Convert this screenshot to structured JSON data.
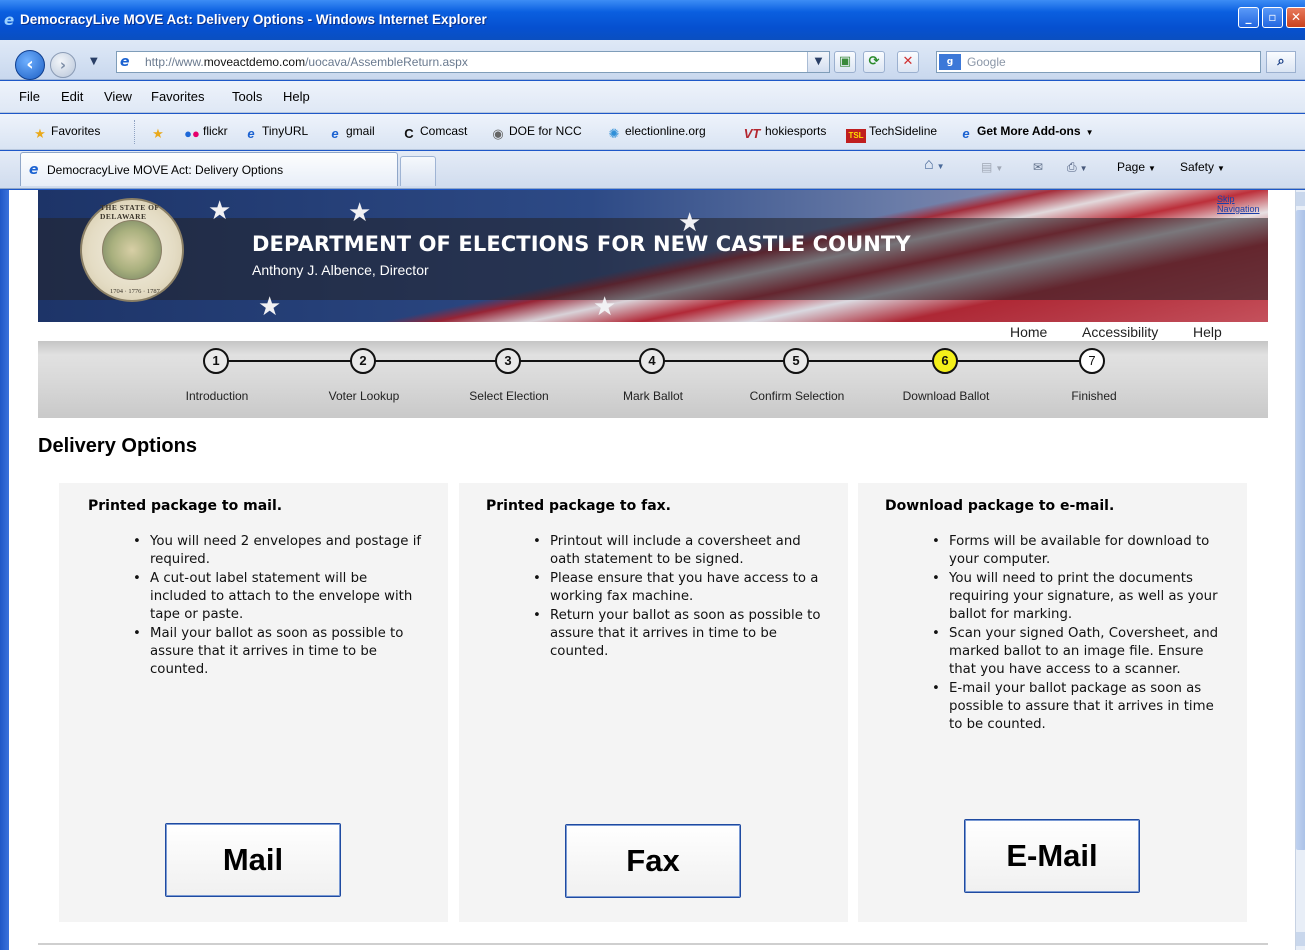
{
  "window": {
    "title": "DemocracyLive MOVE Act: Delivery Options - Windows Internet Explorer",
    "min": "_",
    "max": "▫",
    "close": "✕"
  },
  "navigation": {
    "url_prefix": "http://www.",
    "url_domain": "moveactdemo.com",
    "url_path": "/uocava/AssembleReturn.aspx",
    "search_placeholder": "Google"
  },
  "menu": [
    "File",
    "Edit",
    "View",
    "Favorites",
    "Tools",
    "Help"
  ],
  "favorites": {
    "label": "Favorites",
    "items": [
      "flickr",
      "TinyURL",
      "gmail",
      "Comcast",
      "DOE for NCC",
      "electionline.org",
      "hokiesports",
      "TechSideline",
      "Get More Add-ons"
    ]
  },
  "tab": {
    "title": "DemocracyLive MOVE Act: Delivery Options"
  },
  "command_bar": {
    "page": "Page",
    "safety": "Safety"
  },
  "header": {
    "seal_text": "THE STATE OF DELAWARE",
    "seal_years": "1704 · 1776 · 1787",
    "title": "DEPARTMENT OF ELECTIONS FOR NEW CASTLE COUNTY",
    "subtitle": "Anthony J. Albence, Director",
    "skip_nav": "Skip Navigation"
  },
  "top_links": [
    "Home",
    "Accessibility",
    "Help"
  ],
  "steps": [
    {
      "number": "1",
      "label": "Introduction"
    },
    {
      "number": "2",
      "label": "Voter Lookup"
    },
    {
      "number": "3",
      "label": "Select Election"
    },
    {
      "number": "4",
      "label": "Mark Ballot"
    },
    {
      "number": "5",
      "label": "Confirm Selection"
    },
    {
      "number": "6",
      "label": "Download Ballot"
    },
    {
      "number": "7",
      "label": "Finished"
    }
  ],
  "current_step": 6,
  "page_heading": "Delivery Options",
  "options": [
    {
      "title": "Printed package to mail.",
      "bullets": [
        "You will need 2 envelopes and postage if required.",
        "A cut-out label statement will be included to attach to the envelope with tape or paste.",
        "Mail your ballot as soon as possible to assure that it arrives in time to be counted."
      ],
      "button": "Mail"
    },
    {
      "title": "Printed package to fax.",
      "bullets": [
        "Printout will include a coversheet and oath statement to be signed.",
        "Please ensure that you have access to a working fax machine.",
        "Return your ballot as soon as possible to assure that it arrives in time to be counted."
      ],
      "button": "Fax"
    },
    {
      "title": "Download package to e-mail.",
      "bullets": [
        "Forms will be available for download to your computer.",
        "You will need to print the documents requiring your signature, as well as your ballot for marking.",
        "Scan your signed Oath, Coversheet, and marked ballot to an image file. Ensure that you have access to a scanner.",
        "E-mail your ballot package as soon as possible to assure that it arrives in time to be counted."
      ],
      "button": "E-Mail"
    }
  ],
  "colors": {
    "current_step": "#f4f01a",
    "xp_blue": "#0a5fe0",
    "card_bg": "#f4f4f4"
  }
}
